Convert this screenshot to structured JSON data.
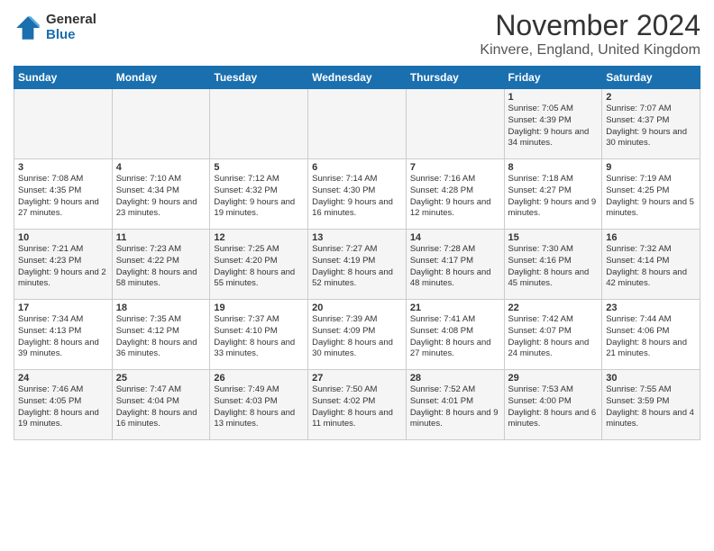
{
  "logo": {
    "general": "General",
    "blue": "Blue"
  },
  "header": {
    "month": "November 2024",
    "location": "Kinvere, England, United Kingdom"
  },
  "days_of_week": [
    "Sunday",
    "Monday",
    "Tuesday",
    "Wednesday",
    "Thursday",
    "Friday",
    "Saturday"
  ],
  "weeks": [
    [
      {
        "day": "",
        "info": ""
      },
      {
        "day": "",
        "info": ""
      },
      {
        "day": "",
        "info": ""
      },
      {
        "day": "",
        "info": ""
      },
      {
        "day": "",
        "info": ""
      },
      {
        "day": "1",
        "info": "Sunrise: 7:05 AM\nSunset: 4:39 PM\nDaylight: 9 hours and 34 minutes."
      },
      {
        "day": "2",
        "info": "Sunrise: 7:07 AM\nSunset: 4:37 PM\nDaylight: 9 hours and 30 minutes."
      }
    ],
    [
      {
        "day": "3",
        "info": "Sunrise: 7:08 AM\nSunset: 4:35 PM\nDaylight: 9 hours and 27 minutes."
      },
      {
        "day": "4",
        "info": "Sunrise: 7:10 AM\nSunset: 4:34 PM\nDaylight: 9 hours and 23 minutes."
      },
      {
        "day": "5",
        "info": "Sunrise: 7:12 AM\nSunset: 4:32 PM\nDaylight: 9 hours and 19 minutes."
      },
      {
        "day": "6",
        "info": "Sunrise: 7:14 AM\nSunset: 4:30 PM\nDaylight: 9 hours and 16 minutes."
      },
      {
        "day": "7",
        "info": "Sunrise: 7:16 AM\nSunset: 4:28 PM\nDaylight: 9 hours and 12 minutes."
      },
      {
        "day": "8",
        "info": "Sunrise: 7:18 AM\nSunset: 4:27 PM\nDaylight: 9 hours and 9 minutes."
      },
      {
        "day": "9",
        "info": "Sunrise: 7:19 AM\nSunset: 4:25 PM\nDaylight: 9 hours and 5 minutes."
      }
    ],
    [
      {
        "day": "10",
        "info": "Sunrise: 7:21 AM\nSunset: 4:23 PM\nDaylight: 9 hours and 2 minutes."
      },
      {
        "day": "11",
        "info": "Sunrise: 7:23 AM\nSunset: 4:22 PM\nDaylight: 8 hours and 58 minutes."
      },
      {
        "day": "12",
        "info": "Sunrise: 7:25 AM\nSunset: 4:20 PM\nDaylight: 8 hours and 55 minutes."
      },
      {
        "day": "13",
        "info": "Sunrise: 7:27 AM\nSunset: 4:19 PM\nDaylight: 8 hours and 52 minutes."
      },
      {
        "day": "14",
        "info": "Sunrise: 7:28 AM\nSunset: 4:17 PM\nDaylight: 8 hours and 48 minutes."
      },
      {
        "day": "15",
        "info": "Sunrise: 7:30 AM\nSunset: 4:16 PM\nDaylight: 8 hours and 45 minutes."
      },
      {
        "day": "16",
        "info": "Sunrise: 7:32 AM\nSunset: 4:14 PM\nDaylight: 8 hours and 42 minutes."
      }
    ],
    [
      {
        "day": "17",
        "info": "Sunrise: 7:34 AM\nSunset: 4:13 PM\nDaylight: 8 hours and 39 minutes."
      },
      {
        "day": "18",
        "info": "Sunrise: 7:35 AM\nSunset: 4:12 PM\nDaylight: 8 hours and 36 minutes."
      },
      {
        "day": "19",
        "info": "Sunrise: 7:37 AM\nSunset: 4:10 PM\nDaylight: 8 hours and 33 minutes."
      },
      {
        "day": "20",
        "info": "Sunrise: 7:39 AM\nSunset: 4:09 PM\nDaylight: 8 hours and 30 minutes."
      },
      {
        "day": "21",
        "info": "Sunrise: 7:41 AM\nSunset: 4:08 PM\nDaylight: 8 hours and 27 minutes."
      },
      {
        "day": "22",
        "info": "Sunrise: 7:42 AM\nSunset: 4:07 PM\nDaylight: 8 hours and 24 minutes."
      },
      {
        "day": "23",
        "info": "Sunrise: 7:44 AM\nSunset: 4:06 PM\nDaylight: 8 hours and 21 minutes."
      }
    ],
    [
      {
        "day": "24",
        "info": "Sunrise: 7:46 AM\nSunset: 4:05 PM\nDaylight: 8 hours and 19 minutes."
      },
      {
        "day": "25",
        "info": "Sunrise: 7:47 AM\nSunset: 4:04 PM\nDaylight: 8 hours and 16 minutes."
      },
      {
        "day": "26",
        "info": "Sunrise: 7:49 AM\nSunset: 4:03 PM\nDaylight: 8 hours and 13 minutes."
      },
      {
        "day": "27",
        "info": "Sunrise: 7:50 AM\nSunset: 4:02 PM\nDaylight: 8 hours and 11 minutes."
      },
      {
        "day": "28",
        "info": "Sunrise: 7:52 AM\nSunset: 4:01 PM\nDaylight: 8 hours and 9 minutes."
      },
      {
        "day": "29",
        "info": "Sunrise: 7:53 AM\nSunset: 4:00 PM\nDaylight: 8 hours and 6 minutes."
      },
      {
        "day": "30",
        "info": "Sunrise: 7:55 AM\nSunset: 3:59 PM\nDaylight: 8 hours and 4 minutes."
      }
    ]
  ]
}
